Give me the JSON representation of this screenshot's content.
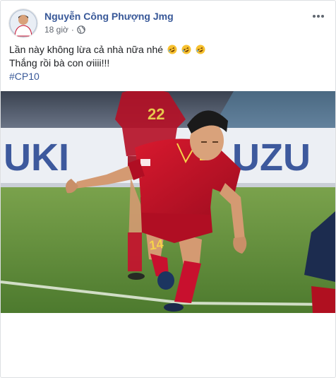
{
  "post": {
    "author": "Nguyễn Công Phượng Jmg",
    "timestamp": "18 giờ",
    "privacy_icon": "globe-icon",
    "more_icon": "more-options-icon",
    "text_lines": {
      "line1": "Lần này không lừa cả nhà nữa nhé",
      "line2": "Thắng rồi bà con ơiiii!!!",
      "hashtag": "#CP10"
    },
    "emoji_name": "rolling-on-the-floor-laughing",
    "emoji_count": 3
  },
  "photo": {
    "background_text_left": "UKI",
    "background_text_right": "UZU",
    "player_number_main": "14",
    "player_number_back": "22"
  },
  "colors": {
    "link": "#385898",
    "meta": "#616770",
    "border": "#dddfe2",
    "jersey_red": "#c8102e",
    "pitch_green": "#5f8f3a"
  }
}
